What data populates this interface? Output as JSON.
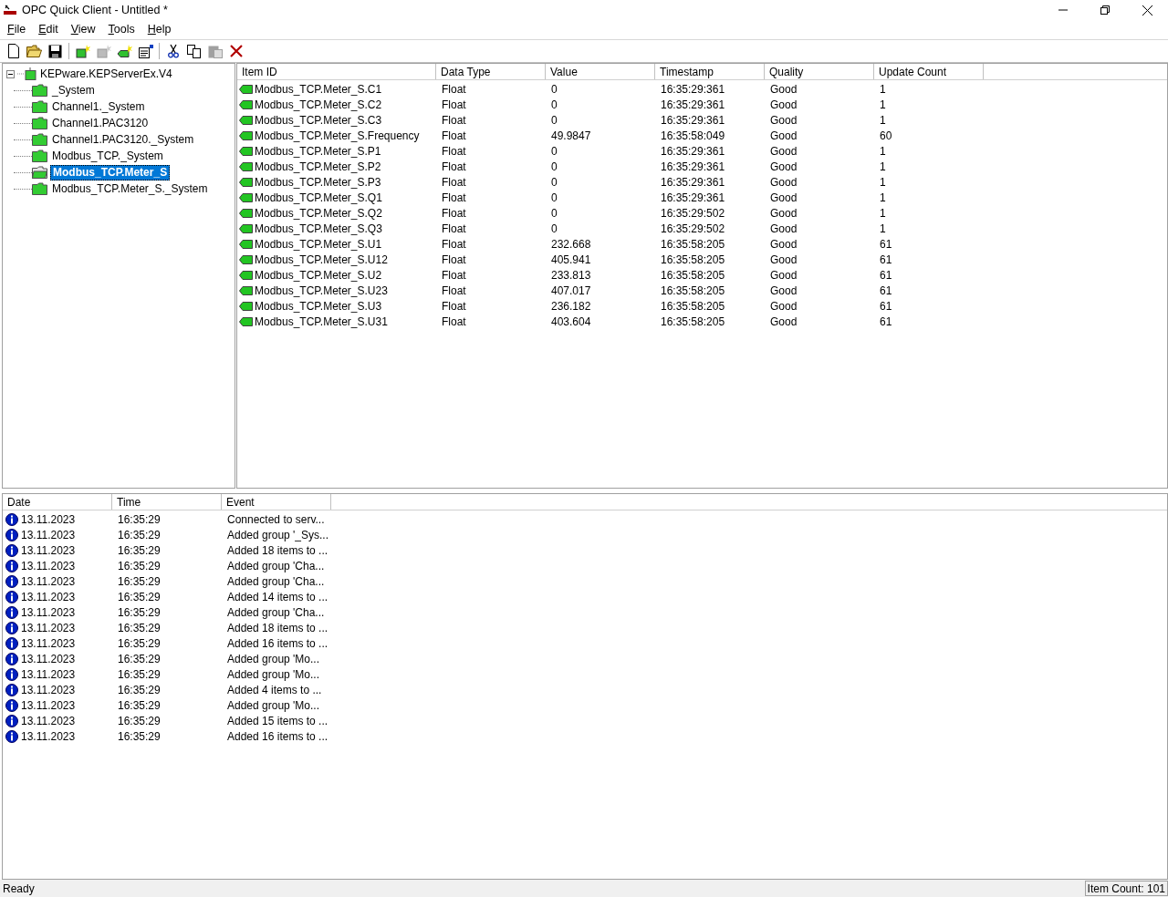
{
  "window": {
    "title": "OPC Quick Client - Untitled *"
  },
  "menu": [
    {
      "label": "File"
    },
    {
      "label": "Edit"
    },
    {
      "label": "View"
    },
    {
      "label": "Tools"
    },
    {
      "label": "Help"
    }
  ],
  "toolbar": [
    [
      {
        "disabled": false
      },
      {
        "disabled": false
      },
      {
        "disabled": false
      }
    ],
    [
      {
        "disabled": false
      },
      {
        "disabled": true
      },
      {
        "disabled": false
      },
      {
        "disabled": false
      }
    ],
    [
      {
        "disabled": false
      },
      {
        "disabled": false
      },
      {
        "disabled": true
      },
      {
        "disabled": false
      }
    ]
  ],
  "tree": {
    "label": "KEPware.KEPServerEx.V4",
    "expanded": true,
    "children": [
      {
        "label": "_System",
        "selected": false
      },
      {
        "label": "Channel1._System",
        "selected": false
      },
      {
        "label": "Channel1.PAC3120",
        "selected": false
      },
      {
        "label": "Channel1.PAC3120._System",
        "selected": false
      },
      {
        "label": "Modbus_TCP._System",
        "selected": false
      },
      {
        "label": "Modbus_TCP.Meter_S",
        "selected": true
      },
      {
        "label": "Modbus_TCP.Meter_S._System",
        "selected": false
      }
    ]
  },
  "items_table": {
    "columns": [
      "Item ID",
      "Data Type",
      "Value",
      "Timestamp",
      "Quality",
      "Update Count"
    ],
    "rows": [
      [
        "Modbus_TCP.Meter_S.C1",
        "Float",
        "0",
        "16:35:29:361",
        "Good",
        "1"
      ],
      [
        "Modbus_TCP.Meter_S.C2",
        "Float",
        "0",
        "16:35:29:361",
        "Good",
        "1"
      ],
      [
        "Modbus_TCP.Meter_S.C3",
        "Float",
        "0",
        "16:35:29:361",
        "Good",
        "1"
      ],
      [
        "Modbus_TCP.Meter_S.Frequency",
        "Float",
        "49.9847",
        "16:35:58:049",
        "Good",
        "60"
      ],
      [
        "Modbus_TCP.Meter_S.P1",
        "Float",
        "0",
        "16:35:29:361",
        "Good",
        "1"
      ],
      [
        "Modbus_TCP.Meter_S.P2",
        "Float",
        "0",
        "16:35:29:361",
        "Good",
        "1"
      ],
      [
        "Modbus_TCP.Meter_S.P3",
        "Float",
        "0",
        "16:35:29:361",
        "Good",
        "1"
      ],
      [
        "Modbus_TCP.Meter_S.Q1",
        "Float",
        "0",
        "16:35:29:361",
        "Good",
        "1"
      ],
      [
        "Modbus_TCP.Meter_S.Q2",
        "Float",
        "0",
        "16:35:29:502",
        "Good",
        "1"
      ],
      [
        "Modbus_TCP.Meter_S.Q3",
        "Float",
        "0",
        "16:35:29:502",
        "Good",
        "1"
      ],
      [
        "Modbus_TCP.Meter_S.U1",
        "Float",
        "232.668",
        "16:35:58:205",
        "Good",
        "61"
      ],
      [
        "Modbus_TCP.Meter_S.U12",
        "Float",
        "405.941",
        "16:35:58:205",
        "Good",
        "61"
      ],
      [
        "Modbus_TCP.Meter_S.U2",
        "Float",
        "233.813",
        "16:35:58:205",
        "Good",
        "61"
      ],
      [
        "Modbus_TCP.Meter_S.U23",
        "Float",
        "407.017",
        "16:35:58:205",
        "Good",
        "61"
      ],
      [
        "Modbus_TCP.Meter_S.U3",
        "Float",
        "236.182",
        "16:35:58:205",
        "Good",
        "61"
      ],
      [
        "Modbus_TCP.Meter_S.U31",
        "Float",
        "403.604",
        "16:35:58:205",
        "Good",
        "61"
      ]
    ]
  },
  "log_table": {
    "columns": [
      "Date",
      "Time",
      "Event"
    ],
    "rows": [
      [
        "13.11.2023",
        "16:35:29",
        "Connected to serv..."
      ],
      [
        "13.11.2023",
        "16:35:29",
        "Added group '_Sys..."
      ],
      [
        "13.11.2023",
        "16:35:29",
        "Added 18 items to ..."
      ],
      [
        "13.11.2023",
        "16:35:29",
        "Added group 'Cha..."
      ],
      [
        "13.11.2023",
        "16:35:29",
        "Added group 'Cha..."
      ],
      [
        "13.11.2023",
        "16:35:29",
        "Added 14 items to ..."
      ],
      [
        "13.11.2023",
        "16:35:29",
        "Added group 'Cha..."
      ],
      [
        "13.11.2023",
        "16:35:29",
        "Added 18 items to ..."
      ],
      [
        "13.11.2023",
        "16:35:29",
        "Added 16 items to ..."
      ],
      [
        "13.11.2023",
        "16:35:29",
        "Added group 'Mo..."
      ],
      [
        "13.11.2023",
        "16:35:29",
        "Added group 'Mo..."
      ],
      [
        "13.11.2023",
        "16:35:29",
        "Added 4 items to ..."
      ],
      [
        "13.11.2023",
        "16:35:29",
        "Added group 'Mo..."
      ],
      [
        "13.11.2023",
        "16:35:29",
        "Added 15 items to ..."
      ],
      [
        "13.11.2023",
        "16:35:29",
        "Added 16 items to ..."
      ]
    ]
  },
  "status_bar": {
    "message": "Ready",
    "item_count": "Item Count: 101"
  }
}
